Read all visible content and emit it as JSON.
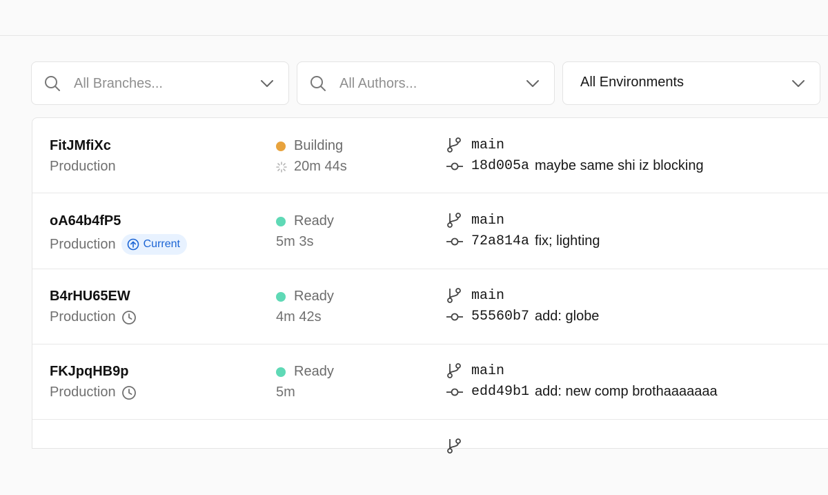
{
  "filters": {
    "branches_placeholder": "All Branches...",
    "authors_placeholder": "All Authors...",
    "environment_value": "All Environments"
  },
  "colors": {
    "building": "#e8a33d",
    "ready": "#5fd9b6",
    "current_badge_bg": "#e8f2ff",
    "current_badge_text": "#1b64d4"
  },
  "deployments": [
    {
      "id": "FitJMfiXc",
      "environment": "Production",
      "status": "Building",
      "duration": "20m 44s",
      "branch": "main",
      "commit_hash": "18d005a",
      "commit_message": "maybe same shi iz blocking"
    },
    {
      "id": "oA64b4fP5",
      "environment": "Production",
      "badge": "Current",
      "status": "Ready",
      "duration": "5m 3s",
      "branch": "main",
      "commit_hash": "72a814a",
      "commit_message": "fix; lighting"
    },
    {
      "id": "B4rHU65EW",
      "environment": "Production",
      "status": "Ready",
      "duration": "4m 42s",
      "branch": "main",
      "commit_hash": "55560b7",
      "commit_message": "add: globe"
    },
    {
      "id": "FKJpqHB9p",
      "environment": "Production",
      "status": "Ready",
      "duration": "5m",
      "branch": "main",
      "commit_hash": "edd49b1",
      "commit_message": "add: new comp brothaaaaaaa"
    }
  ]
}
